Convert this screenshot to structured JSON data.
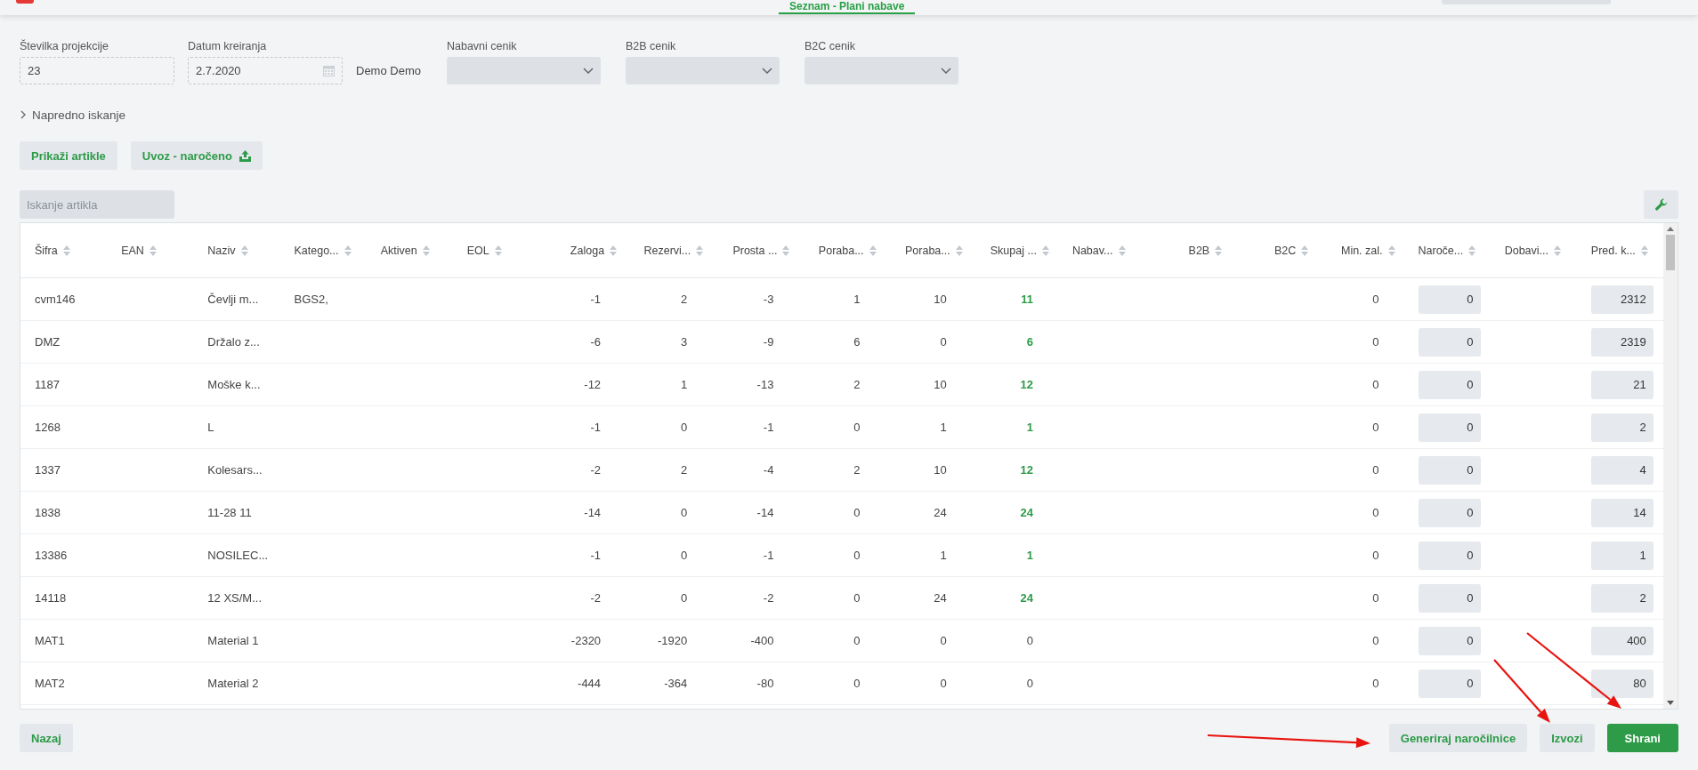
{
  "header": {
    "tab": {
      "label": "Seznam - Plani nabave",
      "selected": true
    }
  },
  "form": {
    "fields": [
      {
        "label": "Številka projekcije",
        "value": "23",
        "kind": "text"
      },
      {
        "label": "Datum kreiranja",
        "value": "2.7.2020",
        "kind": "date"
      }
    ],
    "author": "Demo Demo",
    "selects": [
      {
        "label": "Nabavni cenik"
      },
      {
        "label": "B2B cenik"
      },
      {
        "label": "B2C cenik"
      }
    ]
  },
  "advanced_search": {
    "label": "Napredno iskanje",
    "expanded": false
  },
  "actions": [
    {
      "label": "Prikaži artikle",
      "kind": "plain"
    },
    {
      "label": "Uvoz - naročeno",
      "kind": "upload"
    }
  ],
  "search": {
    "placeholder": "Iskanje artikla"
  },
  "table": {
    "columns": [
      {
        "label": "Šifra",
        "kind": "text"
      },
      {
        "label": "EAN",
        "kind": "text"
      },
      {
        "label": "Naziv",
        "kind": "text"
      },
      {
        "label": "Katego...",
        "kind": "text"
      },
      {
        "label": "Aktiven",
        "kind": "text"
      },
      {
        "label": "EOL",
        "kind": "text"
      },
      {
        "label": "Zaloga",
        "kind": "number"
      },
      {
        "label": "Rezervi...",
        "kind": "number"
      },
      {
        "label": "Prosta ...",
        "kind": "number"
      },
      {
        "label": "Poraba...",
        "kind": "number"
      },
      {
        "label": "Poraba...",
        "kind": "number"
      },
      {
        "label": "Skupaj ...",
        "kind": "number"
      },
      {
        "label": "Nabav...",
        "kind": "text"
      },
      {
        "label": "B2B",
        "kind": "number"
      },
      {
        "label": "B2C",
        "kind": "number"
      },
      {
        "label": "Min. zal.",
        "kind": "number"
      },
      {
        "label": "Naroče...",
        "kind": "input"
      },
      {
        "label": "Dobavi...",
        "kind": "text"
      },
      {
        "label": "Pred. k...",
        "kind": "input"
      }
    ],
    "rows": [
      {
        "code": "cvm146",
        "name": "Čevlji m...",
        "category": "BGS2,",
        "stock": "-1",
        "reserved": "2",
        "free": "-3",
        "usage_1": "1",
        "usage_2": "10",
        "total": "11",
        "total_highlighted": true,
        "min_stock": "0",
        "ordered": "0",
        "predicted": "2312"
      },
      {
        "code": "DMZ",
        "name": "Držalo z...",
        "stock": "-6",
        "reserved": "3",
        "free": "-9",
        "usage_1": "6",
        "usage_2": "0",
        "total": "6",
        "total_highlighted": true,
        "min_stock": "0",
        "ordered": "0",
        "predicted": "2319"
      },
      {
        "code": "1187",
        "name": "Moške k...",
        "stock": "-12",
        "reserved": "1",
        "free": "-13",
        "usage_1": "2",
        "usage_2": "10",
        "total": "12",
        "total_highlighted": true,
        "min_stock": "0",
        "ordered": "0",
        "predicted": "21"
      },
      {
        "code": "1268",
        "name": "L",
        "stock": "-1",
        "reserved": "0",
        "free": "-1",
        "usage_1": "0",
        "usage_2": "1",
        "total": "1",
        "total_highlighted": true,
        "min_stock": "0",
        "ordered": "0",
        "predicted": "2"
      },
      {
        "code": "1337",
        "name": "Kolesars...",
        "stock": "-2",
        "reserved": "2",
        "free": "-4",
        "usage_1": "2",
        "usage_2": "10",
        "total": "12",
        "total_highlighted": true,
        "min_stock": "0",
        "ordered": "0",
        "predicted": "4"
      },
      {
        "code": "1838",
        "name": "11-28 11",
        "stock": "-14",
        "reserved": "0",
        "free": "-14",
        "usage_1": "0",
        "usage_2": "24",
        "total": "24",
        "total_highlighted": true,
        "min_stock": "0",
        "ordered": "0",
        "predicted": "14"
      },
      {
        "code": "13386",
        "name": "NOSILEC...",
        "stock": "-1",
        "reserved": "0",
        "free": "-1",
        "usage_1": "0",
        "usage_2": "1",
        "total": "1",
        "total_highlighted": true,
        "min_stock": "0",
        "ordered": "0",
        "predicted": "1"
      },
      {
        "code": "14118",
        "name": "12 XS/M...",
        "stock": "-2",
        "reserved": "0",
        "free": "-2",
        "usage_1": "0",
        "usage_2": "24",
        "total": "24",
        "total_highlighted": true,
        "min_stock": "0",
        "ordered": "0",
        "predicted": "2"
      },
      {
        "code": "MAT1",
        "name": "Material 1",
        "stock": "-2320",
        "reserved": "-1920",
        "free": "-400",
        "usage_1": "0",
        "usage_2": "0",
        "total": "0",
        "total_highlighted": false,
        "min_stock": "0",
        "ordered": "0",
        "predicted": "400"
      },
      {
        "code": "MAT2",
        "name": "Material 2",
        "stock": "-444",
        "reserved": "-364",
        "free": "-80",
        "usage_1": "0",
        "usage_2": "0",
        "total": "0",
        "total_highlighted": false,
        "min_stock": "0",
        "ordered": "0",
        "predicted": "80"
      }
    ]
  },
  "footer": {
    "back": {
      "label": "Nazaj"
    },
    "buttons": [
      {
        "label": "Generiraj naročilnice",
        "kind": "secondary"
      },
      {
        "label": "Izvozi",
        "kind": "secondary"
      },
      {
        "label": "Shrani",
        "kind": "primary"
      }
    ]
  }
}
